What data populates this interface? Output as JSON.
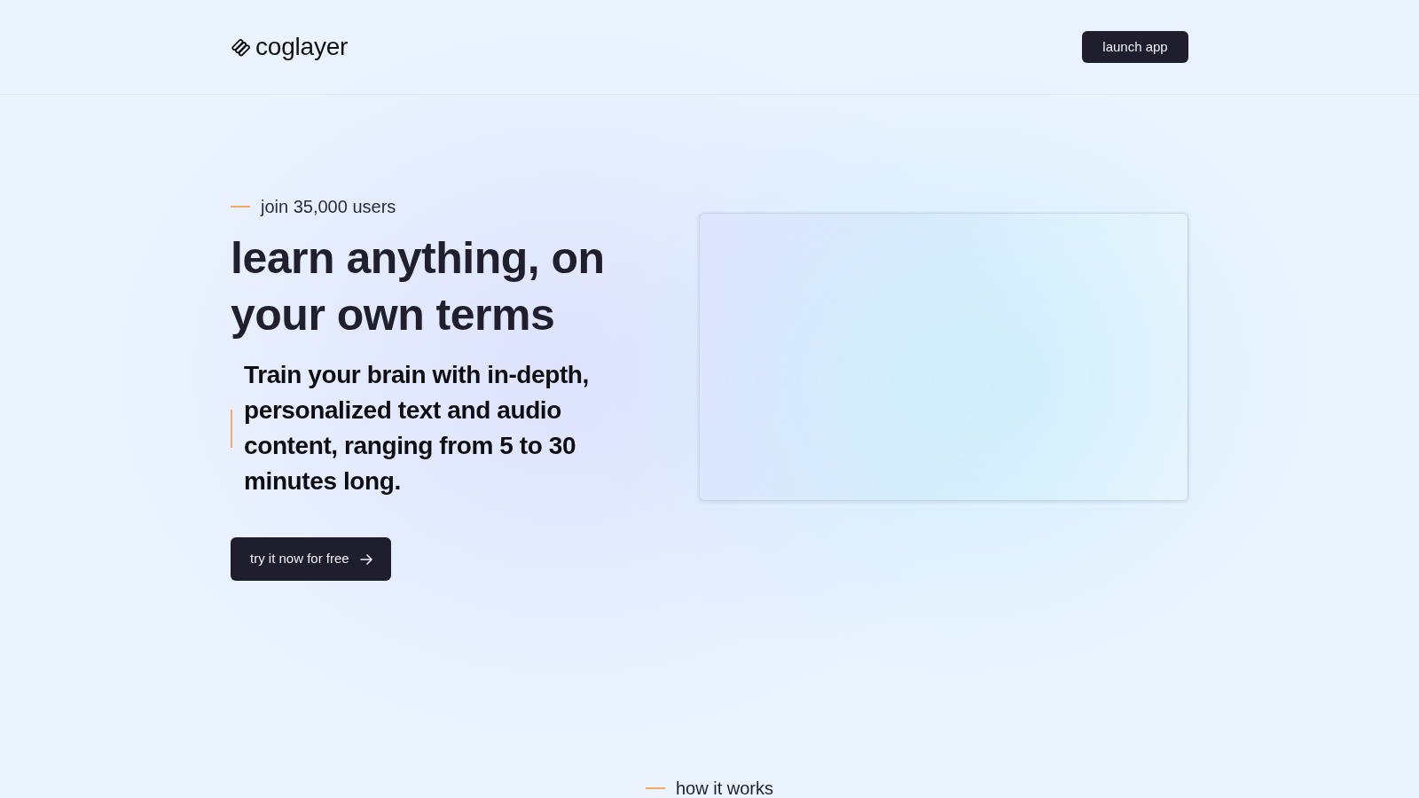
{
  "header": {
    "logo_text": "coglayer",
    "launch_button": "launch app"
  },
  "hero": {
    "eyebrow": "join 35,000 users",
    "title": "learn anything, on your own terms",
    "subtitle": "Train your brain with in-depth, personalized text and audio content, ranging from 5 to 30 minutes long.",
    "cta_button": "try it now for free"
  },
  "next_section": {
    "eyebrow": "how it works"
  }
}
